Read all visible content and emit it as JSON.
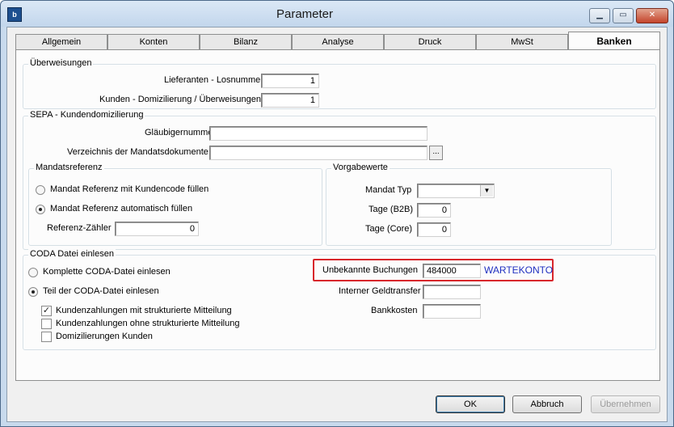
{
  "window": {
    "title": "Parameter",
    "icon": "app-icon",
    "controls": {
      "minimize": "minimize-icon",
      "maximize": "maximize-icon",
      "close": "close-icon"
    }
  },
  "tabs": [
    "Allgemein",
    "Konten",
    "Bilanz",
    "Analyse",
    "Druck",
    "MwSt",
    "Banken"
  ],
  "active_tab": "Banken",
  "ueberweisungen": {
    "legend": "Überweisungen",
    "lieferanten_label": "Lieferanten - Losnummer",
    "lieferanten_value": "1",
    "kunden_label": "Kunden - Domizilierung / Überweisungen",
    "kunden_value": "1"
  },
  "sepa": {
    "legend": "SEPA - Kundendomizilierung",
    "glaeubiger_label": "Gläubigernummer",
    "glaeubiger_value": "",
    "verzeichnis_label": "Verzeichnis der Mandatsdokumente",
    "verzeichnis_value": "",
    "browse_label": "...",
    "mandatsreferenz": {
      "legend": "Mandatsreferenz",
      "option1": "Mandat Referenz mit Kundencode füllen",
      "option2": "Mandat Referenz automatisch füllen",
      "selected": "option2",
      "zaehler_label": "Referenz-Zähler",
      "zaehler_value": "0"
    },
    "vorgabewerte": {
      "legend": "Vorgabewerte",
      "mandat_typ_label": "Mandat Typ",
      "mandat_typ_value": "",
      "b2b_label": "Tage (B2B)",
      "b2b_value": "0",
      "core_label": "Tage (Core)",
      "core_value": "0"
    }
  },
  "coda": {
    "legend": "CODA Datei einlesen",
    "option_komplett": "Komplette CODA-Datei einlesen",
    "option_teil": "Teil der CODA-Datei einlesen",
    "selected": "teil",
    "check1": "Kundenzahlungen mit strukturierte Mitteilung",
    "check1_checked": true,
    "check2": "Kundenzahlungen ohne strukturierte Mitteilung",
    "check2_checked": false,
    "check3": "Domizilierungen Kunden",
    "check3_checked": false,
    "unbekannte_label": "Unbekannte Buchungen",
    "unbekannte_value": "484000",
    "unbekannte_konto": "WARTEKONTO",
    "geldtransfer_label": "Interner Geldtransfer",
    "geldtransfer_value": "",
    "bankkosten_label": "Bankkosten",
    "bankkosten_value": ""
  },
  "buttons": {
    "ok": "OK",
    "abbruch": "Abbruch",
    "uebernehmen": "Übernehmen"
  },
  "colors": {
    "highlight": "#d8262b",
    "konto_text": "#2030c0"
  }
}
